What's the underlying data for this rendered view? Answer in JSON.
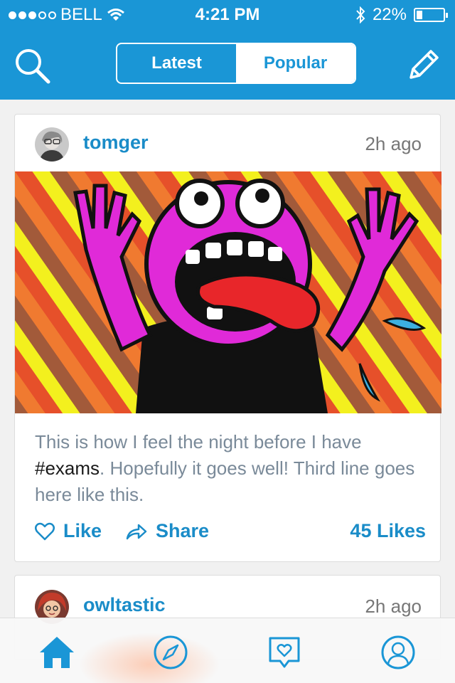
{
  "status_bar": {
    "carrier": "BELL",
    "time": "4:21 PM",
    "battery": "22%",
    "battery_level": 0.22,
    "signal_bars_filled": 3,
    "signal_bars_total": 5,
    "icons": [
      "wifi-icon",
      "bluetooth-icon",
      "battery-icon"
    ]
  },
  "nav": {
    "search_icon": "search-icon",
    "compose_icon": "compose-pencil-icon",
    "tabs": [
      {
        "label": "Latest",
        "selected": false
      },
      {
        "label": "Popular",
        "selected": true
      }
    ]
  },
  "posts": [
    {
      "username": "tomger",
      "time_ago": "2h ago",
      "caption_before": "This is how I feel the night before I have ",
      "hashtag": "#exams",
      "caption_after": ". Hopefully it goes well! Third line goes here like this.",
      "like_label": "Like",
      "share_label": "Share",
      "likes_count": "45 Likes"
    },
    {
      "username": "owltastic",
      "time_ago": "2h ago"
    }
  ],
  "tab_bar": {
    "items": [
      {
        "icon": "home-icon",
        "active": true
      },
      {
        "icon": "compass-icon",
        "active": false
      },
      {
        "icon": "heart-speech-icon",
        "active": false
      },
      {
        "icon": "profile-icon",
        "active": false
      }
    ]
  },
  "colors": {
    "accent": "#1a96d6",
    "link": "#1a8cc8",
    "caption_text": "#7a8a99"
  }
}
